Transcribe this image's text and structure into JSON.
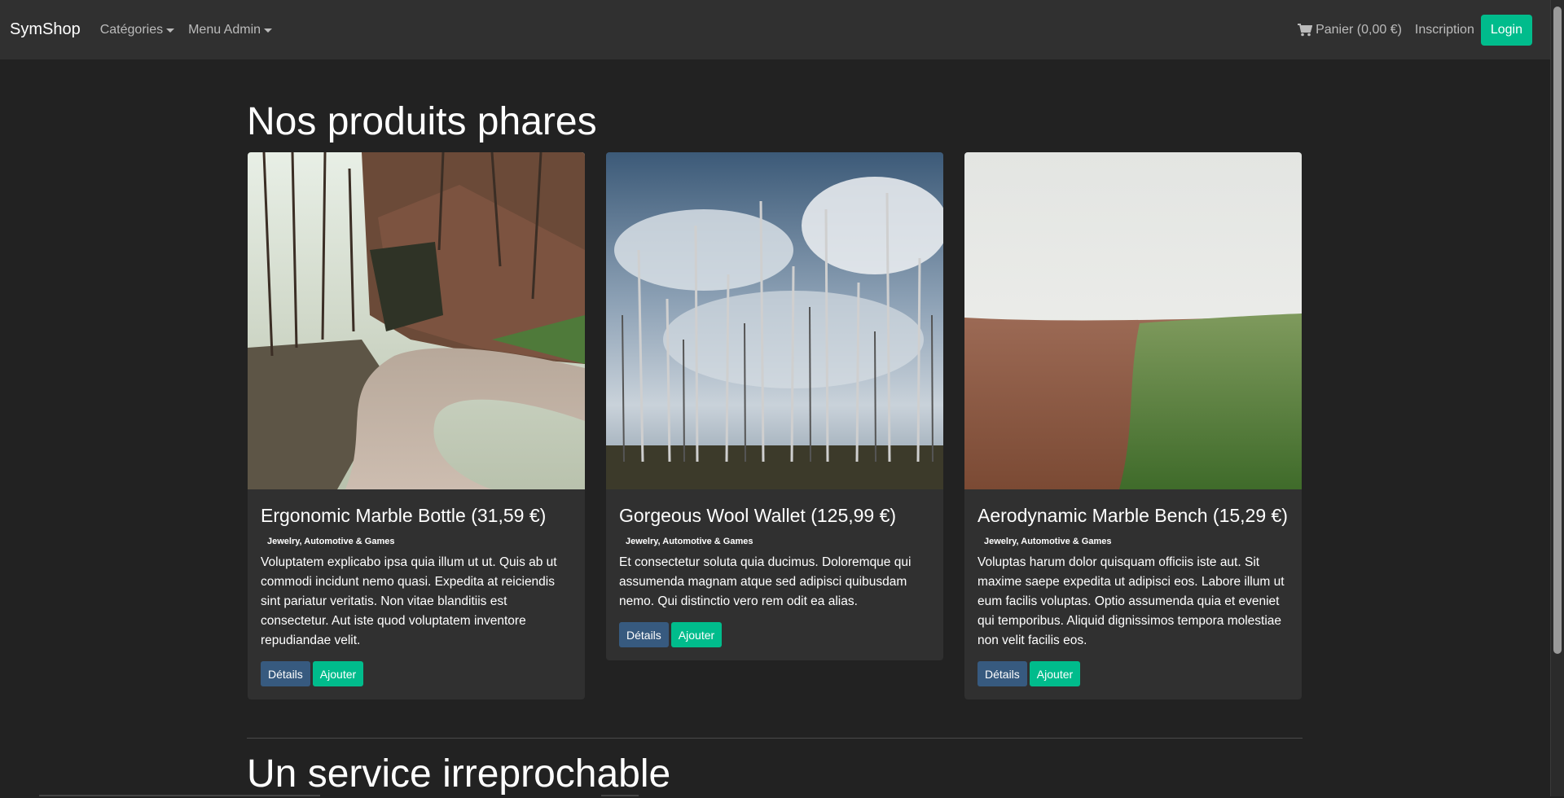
{
  "navbar": {
    "brand": "SymShop",
    "categories_label": "Catégories",
    "admin_menu_label": "Menu Admin",
    "cart_label": "Panier (0,00 €)",
    "signup_label": "Inscription",
    "login_label": "Login"
  },
  "main": {
    "featured_title": "Nos produits phares",
    "service_title": "Un service irreprochable"
  },
  "products": [
    {
      "title": "Ergonomic Marble Bottle (31,59 €)",
      "category": "Jewelry, Automotive & Games",
      "description": "Voluptatem explicabo ipsa quia illum ut ut. Quis ab ut commodi incidunt nemo quasi. Expedita at reiciendis sint pariatur veritatis. Non vitae blanditiis est consectetur. Aut iste quod voluptatem inventore repudiandae velit.",
      "details_label": "Détails",
      "add_label": "Ajouter",
      "image": "forest-road-photo"
    },
    {
      "title": "Gorgeous Wool Wallet (125,99 €)",
      "category": "Jewelry, Automotive & Games",
      "description": "Et consectetur soluta quia ducimus. Doloremque qui assumenda magnam atque sed adipisci quibusdam nemo. Qui distinctio vero rem odit ea alias.",
      "details_label": "Détails",
      "add_label": "Ajouter",
      "image": "dead-trees-sky-photo"
    },
    {
      "title": "Aerodynamic Marble Bench (15,29 €)",
      "category": "Jewelry, Automotive & Games",
      "description": "Voluptas harum dolor quisquam officiis iste aut. Sit maxime saepe expedita ut adipisci eos. Labore illum ut eum facilis voluptas. Optio assumenda quia et eveniet qui temporibus. Aliquid dignissimos tempora molestiae non velit facilis eos.",
      "details_label": "Détails",
      "add_label": "Ajouter",
      "image": "plowed-field-photo"
    }
  ],
  "colors": {
    "background": "#222222",
    "navbar": "#303030",
    "primary": "#375a7f",
    "success": "#00bc8c"
  }
}
